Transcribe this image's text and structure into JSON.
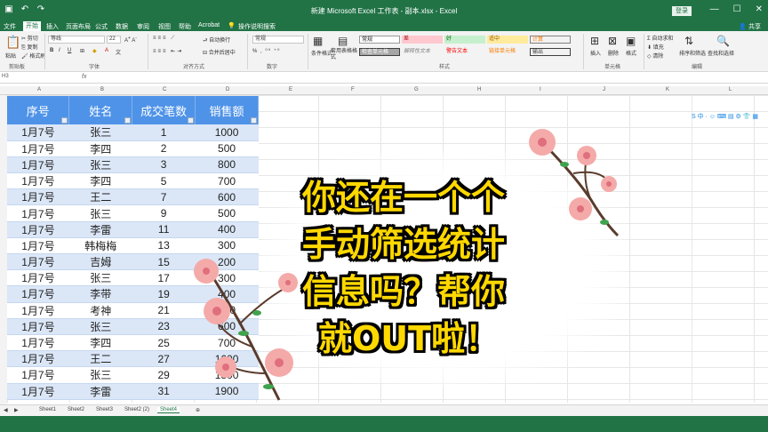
{
  "titlebar": {
    "title": "新建 Microsoft Excel 工作表 - 副本.xlsx - Excel",
    "login": "登录",
    "minimize": "—",
    "maximize": "☐",
    "close": "✕"
  },
  "tabs": [
    "文件",
    "开始",
    "插入",
    "页面布局",
    "公式",
    "数据",
    "审阅",
    "视图",
    "帮助",
    "Acrobat",
    "操作说明搜索"
  ],
  "share": "共享",
  "ribbon": {
    "clipboard": {
      "paste": "粘贴",
      "cut": "剪切",
      "copy": "复制",
      "format": "格式刷",
      "label": "剪贴板"
    },
    "font": {
      "name": "等线",
      "size": "22",
      "label": "字体"
    },
    "align": {
      "wrap": "自动换行",
      "merge": "合并后居中",
      "label": "对齐方式"
    },
    "number": {
      "format": "常规",
      "label": "数字"
    },
    "styles": {
      "cond": "条件格式",
      "table": "套用表格格式",
      "label": "样式",
      "cells": [
        "常规",
        "差",
        "好",
        "适中",
        "计算",
        "检查单元格",
        "解释性文本",
        "警告文本",
        "链接单元格",
        "输出"
      ]
    },
    "cells_grp": {
      "insert": "插入",
      "delete": "删除",
      "format": "格式",
      "label": "单元格"
    },
    "edit": {
      "autosum": "自动求和",
      "fill": "填充",
      "clear": "清除",
      "sort": "排序和筛选",
      "find": "查找和选择",
      "label": "编辑"
    }
  },
  "namebox": "H3",
  "fx": "fx",
  "columns": [
    "A",
    "B",
    "C",
    "D",
    "E",
    "F",
    "G",
    "H",
    "I",
    "J",
    "K",
    "L"
  ],
  "table": {
    "headers": [
      "序号",
      "姓名",
      "成交笔数",
      "销售额"
    ],
    "rows": [
      [
        "1月7号",
        "张三",
        "1",
        "1000"
      ],
      [
        "1月7号",
        "李四",
        "2",
        "500"
      ],
      [
        "1月7号",
        "张三",
        "3",
        "800"
      ],
      [
        "1月7号",
        "李四",
        "5",
        "700"
      ],
      [
        "1月7号",
        "王二",
        "7",
        "600"
      ],
      [
        "1月7号",
        "张三",
        "9",
        "500"
      ],
      [
        "1月7号",
        "李雷",
        "11",
        "400"
      ],
      [
        "1月7号",
        "韩梅梅",
        "13",
        "300"
      ],
      [
        "1月7号",
        "吉姆",
        "15",
        "200"
      ],
      [
        "1月7号",
        "张三",
        "17",
        "300"
      ],
      [
        "1月7号",
        "李带",
        "19",
        "400"
      ],
      [
        "1月7号",
        "考神",
        "21",
        "500"
      ],
      [
        "1月7号",
        "张三",
        "23",
        "600"
      ],
      [
        "1月7号",
        "李四",
        "25",
        "700"
      ],
      [
        "1月7号",
        "王二",
        "27",
        "1600"
      ],
      [
        "1月7号",
        "张三",
        "29",
        "1800"
      ],
      [
        "1月7号",
        "李雷",
        "31",
        "1900"
      ]
    ]
  },
  "headline": [
    "你还在一个个",
    "手动筛选统计",
    "信息吗？帮你",
    "就OUT啦！"
  ],
  "sheets": [
    "Sheet1",
    "Sheet2",
    "Sheet3",
    "Sheet2 (2)",
    "Sheet4"
  ],
  "active_sheet": "Sheet4",
  "colors": {
    "excel_green": "#217346",
    "header_blue": "#4f93e8",
    "band_blue": "#dbe7f7",
    "headline_yellow": "#ffd800"
  }
}
